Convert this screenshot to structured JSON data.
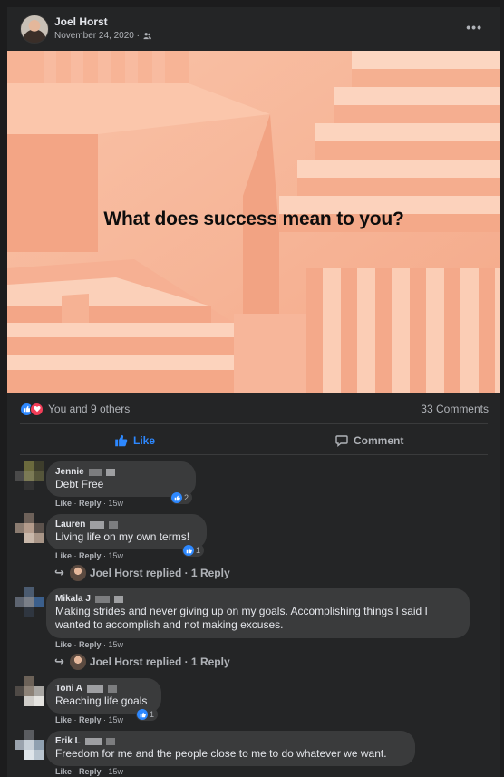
{
  "post": {
    "author": "Joel Horst",
    "date": "November 24, 2020 ·",
    "more_label": "•••",
    "audience_icon": "friends-icon",
    "image_headline": "What does success mean to you?"
  },
  "reactions": {
    "summary": "You and 9 others",
    "icons": [
      "like-icon",
      "love-icon"
    ],
    "comments_count": "33 Comments"
  },
  "actions": {
    "like_label": "Like",
    "comment_label": "Comment"
  },
  "colors": {
    "accent": "#2d88ff",
    "love": "#f33e58",
    "card": "#242526",
    "bubble": "#3a3b3c",
    "image_bg": "#f7b79a"
  },
  "comments": [
    {
      "name": "Jennie",
      "text": "Debt Free",
      "like": "Like",
      "reply": "Reply",
      "time": "15w",
      "reaction_count": "2"
    },
    {
      "name": "Lauren",
      "text": "Living life on my own terms!",
      "like": "Like",
      "reply": "Reply",
      "time": "15w",
      "reaction_count": "1",
      "replies_label": "Joel Horst replied · 1 Reply"
    },
    {
      "name": "Mikala J",
      "text": "Making strides and never giving up on my goals. Accomplishing things I said I wanted to accomplish and not making excuses.",
      "like": "Like",
      "reply": "Reply",
      "time": "15w",
      "replies_label": "Joel Horst replied · 1 Reply"
    },
    {
      "name": "Toni A",
      "text": "Reaching life goals",
      "like": "Like",
      "reply": "Reply",
      "time": "15w",
      "reaction_count": "1"
    },
    {
      "name": "Erik L",
      "text": "Freedom for me and the people close to me to do whatever we want.",
      "like": "Like",
      "reply": "Reply",
      "time": "15w"
    }
  ]
}
